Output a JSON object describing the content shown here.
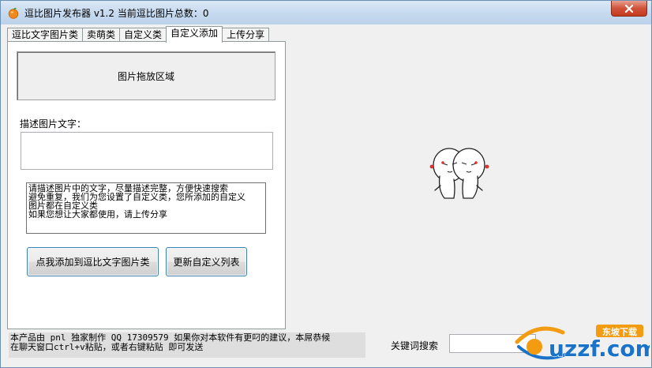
{
  "window": {
    "title": "逗比图片发布器 v1.2 当前逗比图片总数：0"
  },
  "tabs": [
    {
      "label": "逗比文字图片类"
    },
    {
      "label": "卖萌类"
    },
    {
      "label": "自定义类"
    },
    {
      "label": "自定义添加",
      "active": true
    },
    {
      "label": "上传分享"
    }
  ],
  "panel": {
    "drop_zone_label": "图片拖放区域",
    "description_label": "描述图片文字：",
    "description_value": "",
    "help_lines": [
      "请描述图片中的文字，尽量描述完整，方便快速搜索",
      "避免重复，我们为您设置了自定义类，您所添加的自定义",
      "图片都在自定义类",
      "如果您想让大家都使用，请上传分享"
    ],
    "add_button_label": "点我添加到逗比文字图片类",
    "refresh_button_label": "更新自定义列表"
  },
  "footer": {
    "info_lines": [
      "本产品由 pnl 独家制作 QQ 17309579  如果你对本软件有更叼的建议，本屌恭候",
      "在聊天窗口ctrl+v粘贴，或者右键粘贴 即可发送"
    ],
    "keyword_label": "关键词搜索",
    "keyword_value": ""
  },
  "watermark": {
    "brand": "uzzf.com",
    "tag": "东坡下载"
  },
  "icons": {
    "app": "orange-fruit-icon",
    "close": "close-icon"
  },
  "colors": {
    "close_red": "#c23a1f",
    "button_border": "#3c7fb1",
    "watermark_blue": "#1a73c8",
    "watermark_orange": "#f39c12"
  }
}
